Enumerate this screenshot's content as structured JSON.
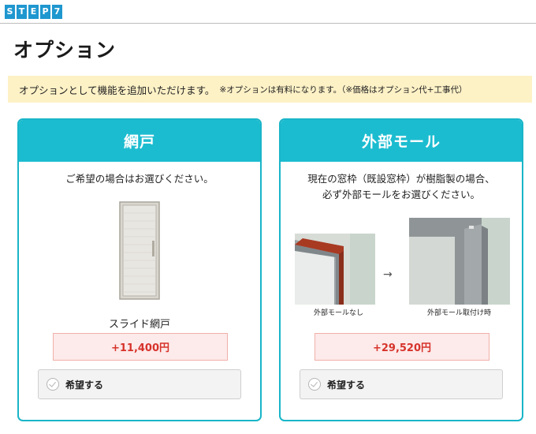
{
  "step_badge": [
    "S",
    "T",
    "E",
    "P",
    "7"
  ],
  "page_title": "オプション",
  "notice": {
    "main": "オプションとして機能を追加いただけます。",
    "sub": "※オプションは有料になります。（※価格はオプション代+工事代）"
  },
  "cards": [
    {
      "title": "網戸",
      "description": [
        "ご希望の場合はお選びください。"
      ],
      "product_name": "スライド網戸",
      "price": "+11,400円",
      "option_label": "希望する",
      "image_icon": "screen-door-image"
    },
    {
      "title": "外部モール",
      "description": [
        "現在の窓枠（既設窓枠）が樹脂製の場合、",
        "必ず外部モールをお選びください。"
      ],
      "images": [
        {
          "caption": "外部モールなし",
          "icon": "frame-without-molding-image"
        },
        {
          "caption": "外部モール取付け時",
          "icon": "frame-with-molding-image"
        }
      ],
      "price": "+29,520円",
      "option_label": "希望する"
    }
  ],
  "colors": {
    "accent": "#1cbcd0",
    "step_blue": "#1f97cf",
    "notice_bg": "#fdf1c6",
    "price_text": "#d6332b",
    "price_bg": "#fdeaea"
  }
}
